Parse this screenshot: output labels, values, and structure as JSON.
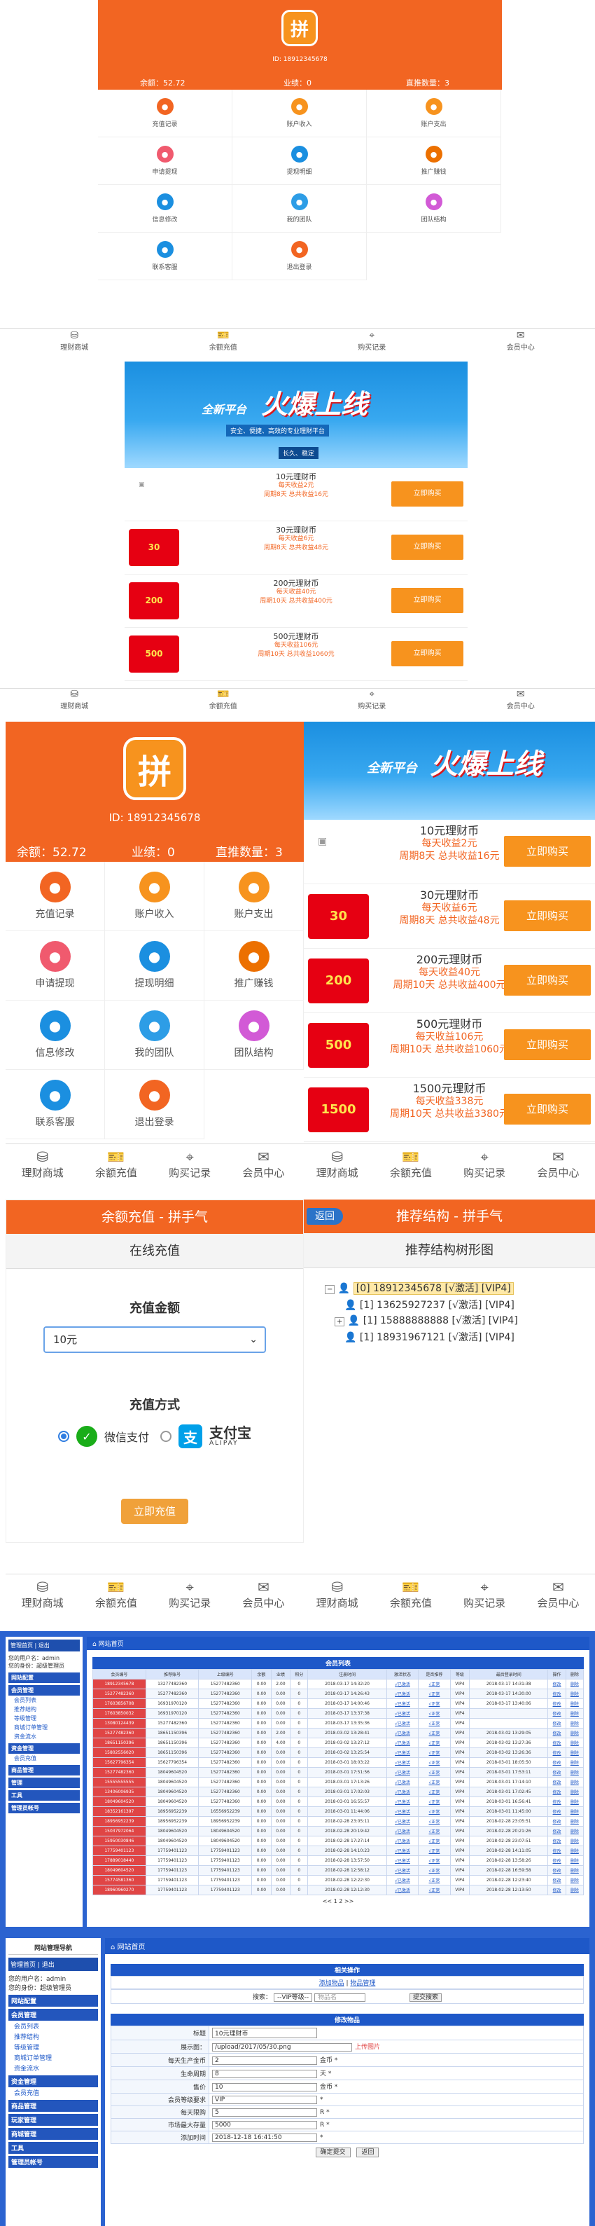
{
  "account": {
    "phone": "18912345678",
    "phone_small": "ID: 18912345678",
    "balance": "余额：52.72",
    "performance": "业绩：0",
    "direct": "直推数量：3"
  },
  "menu": [
    {
      "label": "充值记录",
      "icon": "clipboard-icon",
      "color": "#f26522"
    },
    {
      "label": "账户收入",
      "icon": "coins-icon",
      "color": "#f7931e"
    },
    {
      "label": "账户支出",
      "icon": "moneybag-icon",
      "color": "#f7931e"
    },
    {
      "label": "申请提现",
      "icon": "money-icon",
      "color": "#f05a6e"
    },
    {
      "label": "提现明细",
      "icon": "list-icon",
      "color": "#1b8fe0"
    },
    {
      "label": "推广赚钱",
      "icon": "qrcode-icon",
      "color": "#ec7000"
    },
    {
      "label": "信息修改",
      "icon": "chat-icon",
      "color": "#1b8fe0"
    },
    {
      "label": "我的团队",
      "icon": "team-icon",
      "color": "#2d9de6"
    },
    {
      "label": "团队结构",
      "icon": "star-icon",
      "color": "#d25ad6"
    },
    {
      "label": "联系客服",
      "icon": "service-icon",
      "color": "#1b8fe0"
    },
    {
      "label": "退出登录",
      "icon": "logout-icon",
      "color": "#f26522"
    }
  ],
  "nav": [
    "理财商城",
    "余额充值",
    "购买记录",
    "会员中心"
  ],
  "banner": {
    "line1": "全新平台",
    "hot": "火爆上线",
    "sub": "安全、便捷、高效的专业理财平台",
    "tag": "长久、稳定"
  },
  "products": [
    {
      "name": "10元理财币",
      "daily": "每天收益2元",
      "period": "周期8天 总共收益16元",
      "badge": ""
    },
    {
      "name": "30元理财币",
      "daily": "每天收益6元",
      "period": "周期8天 总共收益48元",
      "badge": "30"
    },
    {
      "name": "200元理财币",
      "daily": "每天收益40元",
      "period": "周期10天 总共收益400元",
      "badge": "200"
    },
    {
      "name": "500元理财币",
      "daily": "每天收益106元",
      "period": "周期10天 总共收益1060元",
      "badge": "500"
    },
    {
      "name": "1500元理财币",
      "daily": "每天收益338元",
      "period": "周期10天 总共收益3380元",
      "badge": "1500"
    }
  ],
  "buy_label": "立即购买",
  "recharge": {
    "title": "余额充值 - 拼手气",
    "section": "在线充值",
    "amount_label": "充值金额",
    "amount_value": "10元",
    "method_label": "充值方式",
    "wechat": "微信支付",
    "alipay": "支付宝",
    "alipay_sub": "ALIPAY",
    "submit": "立即充值"
  },
  "tree": {
    "back": "返回",
    "title": "推荐结构 - 拼手气",
    "section": "推荐结构树形图",
    "nodes": [
      "[0] 18912345678 [√激活] [VIP4]",
      "[1] 13625927237 [√激活] [VIP4]",
      "[1] 15888888888 [√激活] [VIP4]",
      "[1] 18931967121 [√激活] [VIP4]"
    ]
  },
  "admin1": {
    "crumb": "网站首页",
    "side_title": "管理首页 | 退出",
    "side_user": "您的用户名：admin",
    "side_role": "您的身份：超级管理员",
    "side_groups": [
      "网站配置",
      "会员管理",
      "会员列表",
      "推荐结构",
      "等级管理",
      "商城订单管理",
      "资金流水",
      "资金管理",
      "会员充值",
      "商品管理",
      "管理",
      "工具",
      "管理员帐号"
    ],
    "table_title": "会员列表",
    "headers": [
      "会员编号",
      "推荐账号",
      "上级编号",
      "余额",
      "业绩",
      "积分",
      "注册时间",
      "激活状态",
      "是否推荐",
      "等级",
      "最后登录时间",
      "操作",
      "删除"
    ],
    "rows": [
      [
        "18912345678",
        "13277482360",
        "15277482360",
        "0.00",
        "2.00",
        "0",
        "2018-03-17 14:32:20",
        "√已激活",
        "√正常",
        "VIP4",
        "2018-03-17 14:31:38",
        "修改",
        "删除"
      ],
      [
        "15277482360",
        "15277482360",
        "15277482360",
        "0.00",
        "0.00",
        "0",
        "2018-03-17 14:26:43",
        "√已激活",
        "√正常",
        "VIP4",
        "2018-03-17 14:30:00",
        "修改",
        "删除"
      ],
      [
        "17603856708",
        "16931970120",
        "15277482360",
        "0.00",
        "0.00",
        "0",
        "2018-03-17 14:00:46",
        "√已激活",
        "√正常",
        "VIP4",
        "2018-03-17 13:40:06",
        "修改",
        "删除"
      ],
      [
        "17603850032",
        "16931970120",
        "15277482360",
        "0.00",
        "0.00",
        "0",
        "2018-03-17 13:37:38",
        "√已激活",
        "√正常",
        "VIP4",
        "",
        "修改",
        "删除"
      ],
      [
        "13080124439",
        "15277482360",
        "15277482360",
        "0.00",
        "0.00",
        "0",
        "2018-03-17 13:35:36",
        "√已激活",
        "√正常",
        "VIP4",
        "",
        "修改",
        "删除"
      ],
      [
        "15277482360",
        "18651150396",
        "15277482360",
        "0.00",
        "2.00",
        "0",
        "2018-03-02 13:28:41",
        "√已激活",
        "√正常",
        "VIP4",
        "2018-03-02 13:29:05",
        "修改",
        "删除"
      ],
      [
        "18651150396",
        "18651150396",
        "15277482360",
        "0.00",
        "4.00",
        "0",
        "2018-03-02 13:27:12",
        "√已激活",
        "√正常",
        "VIP4",
        "2018-03-02 13:27:36",
        "修改",
        "删除"
      ],
      [
        "15802556020",
        "18651150396",
        "15277482360",
        "0.00",
        "0.00",
        "0",
        "2018-03-02 13:25:54",
        "√已激活",
        "√正常",
        "VIP4",
        "2018-03-02 13:26:36",
        "修改",
        "删除"
      ],
      [
        "15627796354",
        "15627796354",
        "15277482360",
        "0.00",
        "0.00",
        "0",
        "2018-03-01 18:03:22",
        "√已激活",
        "√正常",
        "VIP4",
        "2018-03-01 18:05:50",
        "修改",
        "删除"
      ],
      [
        "15277482360",
        "18049604520",
        "15277482360",
        "0.00",
        "0.00",
        "0",
        "2018-03-01 17:51:56",
        "√已激活",
        "√正常",
        "VIP4",
        "2018-03-01 17:53:11",
        "修改",
        "删除"
      ],
      [
        "15555555555",
        "18049604520",
        "15277482360",
        "0.00",
        "0.00",
        "0",
        "2018-03-01 17:13:26",
        "√已激活",
        "√正常",
        "VIP4",
        "2018-03-01 17:14:10",
        "修改",
        "删除"
      ],
      [
        "13406006935",
        "18049604520",
        "15277482360",
        "0.00",
        "0.00",
        "0",
        "2018-03-01 17:02:03",
        "√已激活",
        "√正常",
        "VIP4",
        "2018-03-01 17:02:45",
        "修改",
        "删除"
      ],
      [
        "18049604520",
        "18049604520",
        "15277482360",
        "0.00",
        "0.00",
        "0",
        "2018-03-01 16:55:57",
        "√已激活",
        "√正常",
        "VIP4",
        "2018-03-01 16:56:41",
        "修改",
        "删除"
      ],
      [
        "18352161397",
        "18956952239",
        "16556952239",
        "0.00",
        "0.00",
        "0",
        "2018-03-01 11:44:06",
        "√已激活",
        "√正常",
        "VIP4",
        "2018-03-01 11:45:00",
        "修改",
        "删除"
      ],
      [
        "18956952239",
        "18956952239",
        "18956952239",
        "0.00",
        "0.00",
        "0",
        "2018-02-28 23:05:11",
        "√已激活",
        "√正常",
        "VIP4",
        "2018-02-28 23:05:51",
        "修改",
        "删除"
      ],
      [
        "15037972064",
        "18049604520",
        "18049604520",
        "0.00",
        "0.00",
        "0",
        "2018-02-28 20:19:42",
        "√已激活",
        "√正常",
        "VIP4",
        "2018-02-28 20:21:26",
        "修改",
        "删除"
      ],
      [
        "15950030846",
        "18049604520",
        "18049604520",
        "0.00",
        "0.00",
        "0",
        "2018-02-28 17:27:14",
        "√已激活",
        "√正常",
        "VIP4",
        "2018-02-28 23:07:51",
        "修改",
        "删除"
      ],
      [
        "17759401123",
        "17759401123",
        "17759401123",
        "0.00",
        "0.00",
        "0",
        "2018-02-28 14:10:23",
        "√已激活",
        "√正常",
        "VIP4",
        "2018-02-28 14:11:05",
        "修改",
        "删除"
      ],
      [
        "17889018440",
        "17759401123",
        "17759401123",
        "0.00",
        "0.00",
        "0",
        "2018-02-28 13:57:50",
        "√已激活",
        "√正常",
        "VIP4",
        "2018-02-28 13:58:26",
        "修改",
        "删除"
      ],
      [
        "18049604520",
        "17759401123",
        "17759401123",
        "0.00",
        "0.00",
        "0",
        "2018-02-28 12:58:12",
        "√已激活",
        "√正常",
        "VIP4",
        "2018-02-28 16:59:58",
        "修改",
        "删除"
      ],
      [
        "15774581360",
        "17759401123",
        "17759401123",
        "0.00",
        "0.00",
        "0",
        "2018-02-28 12:22:30",
        "√已激活",
        "√正常",
        "VIP4",
        "2018-02-28 12:23:40",
        "修改",
        "删除"
      ],
      [
        "18960960270",
        "17759401123",
        "17759401123",
        "0.00",
        "0.00",
        "0",
        "2018-02-28 12:12:30",
        "√已激活",
        "√正常",
        "VIP4",
        "2018-02-28 12:13:50",
        "修改",
        "删除"
      ]
    ],
    "pager": "<< 1 2 >>"
  },
  "admin2": {
    "crumb": "网站首页",
    "side_title": "网站管理导航",
    "side_links": "管理首页 | 退出",
    "side_user": "您的用户名：admin",
    "side_role": "您的身份：超级管理员",
    "side_groups": [
      "网站配置",
      "会员管理",
      "会员列表",
      "推荐结构",
      "等级管理",
      "商城订单管理",
      "资金流水",
      "资金管理",
      "会员充值",
      "商品管理",
      "玩家管理",
      "商城管理",
      "工具",
      "管理员帐号"
    ],
    "related_title": "相关操作",
    "related_links": [
      "添加物品",
      "物品管理"
    ],
    "search_label": "搜索：",
    "search_select": "--VIP等级--",
    "search_placeholder": "物品名",
    "search_btn": "提交搜索",
    "form_title": "修改物品",
    "fields": [
      {
        "label": "标题",
        "value": "10元理财币",
        "note": ""
      },
      {
        "label": "展示图：",
        "value": "/upload/2017/05/30.png",
        "note": "上传图片"
      },
      {
        "label": "每天生产金币",
        "value": "2",
        "note": "金币 *"
      },
      {
        "label": "生命周期",
        "value": "8",
        "note": "天 *"
      },
      {
        "label": "售价",
        "value": "10",
        "note": "金币 *"
      },
      {
        "label": "会员等级要求",
        "value": "VIP",
        "note": "*"
      },
      {
        "label": "每天限购",
        "value": "5",
        "note": "R *"
      },
      {
        "label": "市场最大存量",
        "value": "5000",
        "note": "R *"
      },
      {
        "label": "添加时间",
        "value": "2018-12-18 16:41:50",
        "note": "*"
      }
    ],
    "submit": "确定提交",
    "back": "返回"
  }
}
